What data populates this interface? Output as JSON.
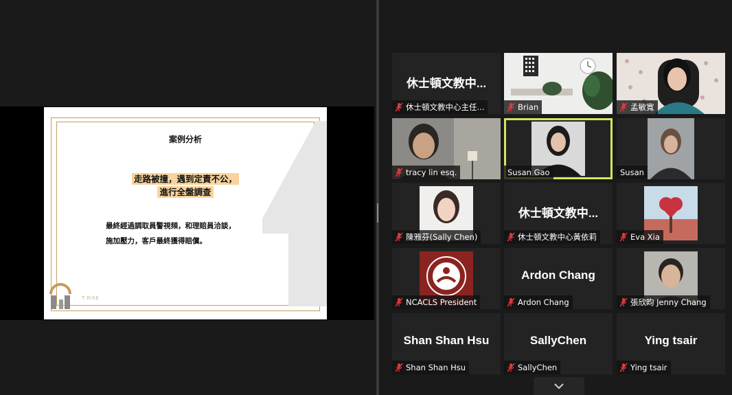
{
  "slide": {
    "title": "案例分析",
    "highlight_lines": [
      "走路被撞，遇到定責不公，",
      "進行全盤調查"
    ],
    "body_lines": [
      "最終經過調取員警視頻，和理賠員洽談，",
      "施加壓力，客戶最終獲得賠償。"
    ],
    "logo_text": "T RISE",
    "accent_color": "#c79b5c",
    "highlight_color": "#f7d39d"
  },
  "gallery": {
    "active_border_color": "#d8e45e",
    "muted_icon": "muted-mic-icon",
    "tiles": [
      {
        "display": "休士頓文教中...",
        "label": "休士頓文教中心主任...",
        "muted": true,
        "video": false
      },
      {
        "display": "",
        "label": "Brian",
        "muted": true,
        "video": true
      },
      {
        "display": "",
        "label": "孟敏寬",
        "muted": true,
        "video": true
      },
      {
        "display": "",
        "label": "tracy lin esq.",
        "muted": true,
        "video": true
      },
      {
        "display": "",
        "label": "Susan Gao",
        "muted": false,
        "video": true,
        "active": true
      },
      {
        "display": "",
        "label": "Susan",
        "muted": false,
        "video": true
      },
      {
        "display": "",
        "label": "陳雅芬(Sally Chen)",
        "muted": true,
        "video": true
      },
      {
        "display": "休士頓文教中...",
        "label": "休士頓文教中心黃依莉",
        "muted": true,
        "video": false
      },
      {
        "display": "",
        "label": "Eva Xia",
        "muted": true,
        "video": true
      },
      {
        "display": "",
        "label": "NCACLS President",
        "muted": true,
        "video": true
      },
      {
        "display": "Ardon Chang",
        "label": "Ardon Chang",
        "muted": true,
        "video": false
      },
      {
        "display": "",
        "label": "張欣昀 Jenny Chang",
        "muted": true,
        "video": true
      },
      {
        "display": "Shan Shan Hsu",
        "label": "Shan Shan Hsu",
        "muted": true,
        "video": false
      },
      {
        "display": "SallyChen",
        "label": "SallyChen",
        "muted": true,
        "video": false
      },
      {
        "display": "Ying tsair",
        "label": "Ying tsair",
        "muted": true,
        "video": false
      }
    ],
    "scroll_icon": "chevron-down-icon"
  }
}
